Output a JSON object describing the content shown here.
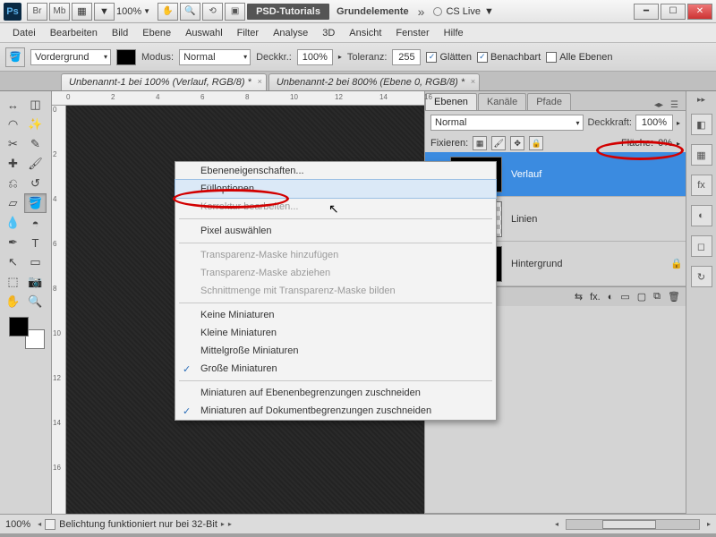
{
  "title_app_abbrev": "Ps",
  "topbar_btns": [
    "Br",
    "Mb",
    "▦",
    "▼"
  ],
  "zoom_combo": "100%",
  "workspace_tag": "PSD-Tutorials",
  "doc_name": "Grundelemente",
  "cslive": "CS Live",
  "menus": [
    "Datei",
    "Bearbeiten",
    "Bild",
    "Ebene",
    "Auswahl",
    "Filter",
    "Analyse",
    "3D",
    "Ansicht",
    "Fenster",
    "Hilfe"
  ],
  "optbar": {
    "fill_label": "Vordergrund",
    "mode_label": "Modus:",
    "mode_value": "Normal",
    "opacity_label": "Deckkr.:",
    "opacity_value": "100%",
    "tolerance_label": "Toleranz:",
    "tolerance_value": "255",
    "cb_antialias": "Glätten",
    "cb_contig": "Benachbart",
    "cb_allLayers": "Alle Ebenen"
  },
  "tabs": [
    "Unbenannt-1 bei 100% (Verlauf, RGB/8) *",
    "Unbenannt-2 bei 800% (Ebene 0, RGB/8) *"
  ],
  "panels": {
    "tabs": [
      "Ebenen",
      "Kanäle",
      "Pfade"
    ],
    "blend": "Normal",
    "opacity_label": "Deckkraft:",
    "opacity": "100%",
    "lock_label": "Fixieren:",
    "fill_label": "Fläche:",
    "fill": "0%",
    "layers": [
      {
        "name": "Verlauf",
        "thumb": "black",
        "selected": true,
        "locked": false
      },
      {
        "name": "Linien",
        "thumb": "trans",
        "selected": false,
        "locked": false
      },
      {
        "name": "Hintergrund",
        "thumb": "black",
        "selected": false,
        "locked": true
      }
    ],
    "footer_icons": [
      "⇆",
      "fx.",
      "◐",
      "▭",
      "▢",
      "⧉",
      "🗑"
    ]
  },
  "ctx": [
    {
      "t": "Ebeneneigenschaften...",
      "d": false
    },
    {
      "t": "Fülloptionen...",
      "d": false,
      "hl": true
    },
    {
      "t": "Korrektur bearbeiten...",
      "d": true
    },
    {
      "sep": true
    },
    {
      "t": "Pixel auswählen",
      "d": false
    },
    {
      "sep": true
    },
    {
      "t": "Transparenz-Maske hinzufügen",
      "d": true
    },
    {
      "t": "Transparenz-Maske abziehen",
      "d": true
    },
    {
      "t": "Schnittmenge mit Transparenz-Maske bilden",
      "d": true
    },
    {
      "sep": true
    },
    {
      "t": "Keine Miniaturen",
      "d": false
    },
    {
      "t": "Kleine Miniaturen",
      "d": false
    },
    {
      "t": "Mittelgroße Miniaturen",
      "d": false
    },
    {
      "t": "Große Miniaturen",
      "d": false,
      "chk": true
    },
    {
      "sep": true
    },
    {
      "t": "Miniaturen auf Ebenenbegrenzungen zuschneiden",
      "d": false
    },
    {
      "t": "Miniaturen auf Dokumentbegrenzungen zuschneiden",
      "d": false,
      "chk": true
    }
  ],
  "ruler_ticks": [
    "0",
    "2",
    "4",
    "6",
    "8",
    "10",
    "12",
    "14",
    "16"
  ],
  "status": {
    "zoom": "100%",
    "exposure": "Belichtung funktioniert nur bei 32-Bit"
  }
}
